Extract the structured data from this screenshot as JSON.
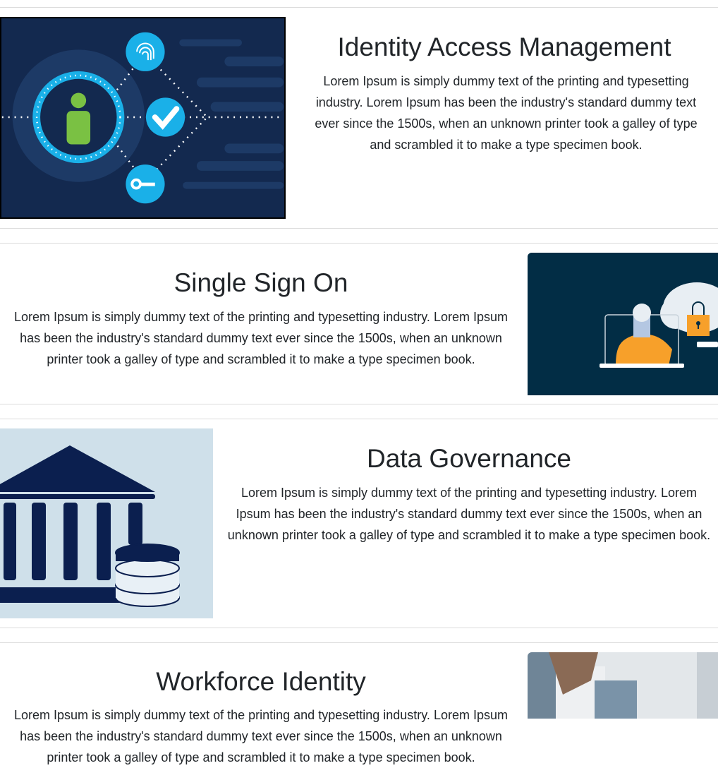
{
  "sections": [
    {
      "title": "Identity Access Management",
      "text": "Lorem Ipsum is simply dummy text of the printing and typesetting industry. Lorem Ipsum has been the industry's standard dummy text ever since the 1500s, when an unknown printer took a galley of type and scrambled it to make a type specimen book.",
      "image": "identity-access-illustration"
    },
    {
      "title": "Single Sign On",
      "text": "Lorem Ipsum is simply dummy text of the printing and typesetting industry. Lorem Ipsum has been the industry's standard dummy text ever since the 1500s, when an unknown printer took a galley of type and scrambled it to make a type specimen book.",
      "image": "single-sign-on-illustration"
    },
    {
      "title": "Data Governance",
      "text": "Lorem Ipsum is simply dummy text of the printing and typesetting industry. Lorem Ipsum has been the industry's standard dummy text ever since the 1500s, when an unknown printer took a galley of type and scrambled it to make a type specimen book.",
      "image": "data-governance-illustration"
    },
    {
      "title": "Workforce Identity",
      "text": "Lorem Ipsum is simply dummy text of the printing and typesetting industry. Lorem Ipsum has been the industry's standard dummy text ever since the 1500s, when an unknown printer took a galley of type and scrambled it to make a type specimen book.",
      "image": "workforce-photo"
    }
  ],
  "colors": {
    "navy": "#13294f",
    "cyan": "#1ab0e8",
    "green": "#7ac143",
    "sso_bg": "#022d45",
    "orange": "#f7a02a",
    "gov_bg": "#cfe0ea",
    "gov_navy": "#0b1f4f"
  }
}
